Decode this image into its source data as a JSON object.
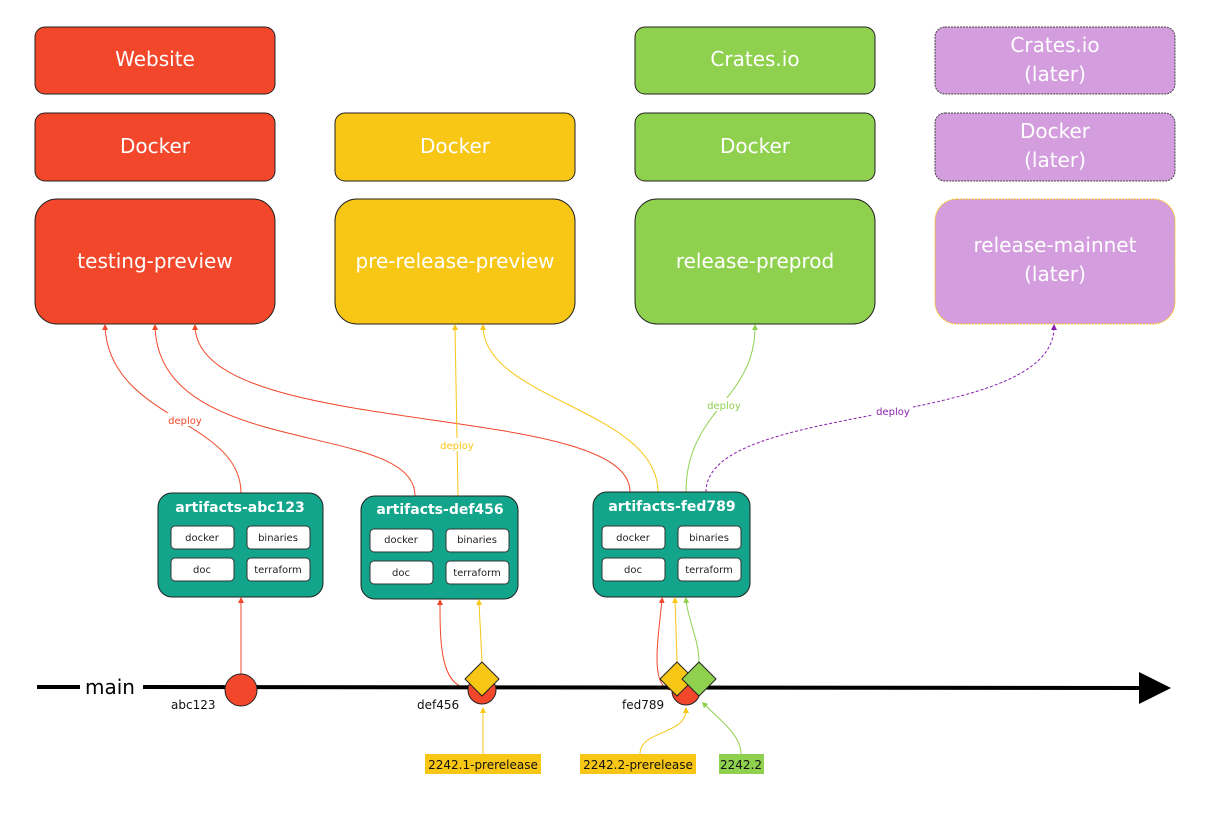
{
  "colors": {
    "testing": "#f2472a",
    "prerelease": "#f8c615",
    "release": "#8fd14f",
    "later": "#d39dde",
    "artifacts": "#12a58b",
    "later_edge": "#8a1fae"
  },
  "columns": [
    {
      "top": "Website",
      "docker": "Docker",
      "env": "testing-preview"
    },
    {
      "docker": "Docker",
      "env": "pre-release-preview"
    },
    {
      "top": "Crates.io",
      "docker": "Docker",
      "env": "release-preprod"
    },
    {
      "top_line1": "Crates.io",
      "top_line2": "(later)",
      "docker_line1": "Docker",
      "docker_line2": "(later)",
      "env_line1": "release-mainnet",
      "env_line2": "(later)"
    }
  ],
  "artifacts": [
    {
      "title": "artifacts-abc123",
      "items": [
        "docker",
        "binaries",
        "doc",
        "terraform"
      ]
    },
    {
      "title": "artifacts-def456",
      "items": [
        "docker",
        "binaries",
        "doc",
        "terraform"
      ]
    },
    {
      "title": "artifacts-fed789",
      "items": [
        "docker",
        "binaries",
        "doc",
        "terraform"
      ]
    }
  ],
  "edge_label": "deploy",
  "branch": "main",
  "commits": [
    "abc123",
    "def456",
    "fed789"
  ],
  "tags": [
    "2242.1-prerelease",
    "2242.2-prerelease",
    "2242.2"
  ]
}
